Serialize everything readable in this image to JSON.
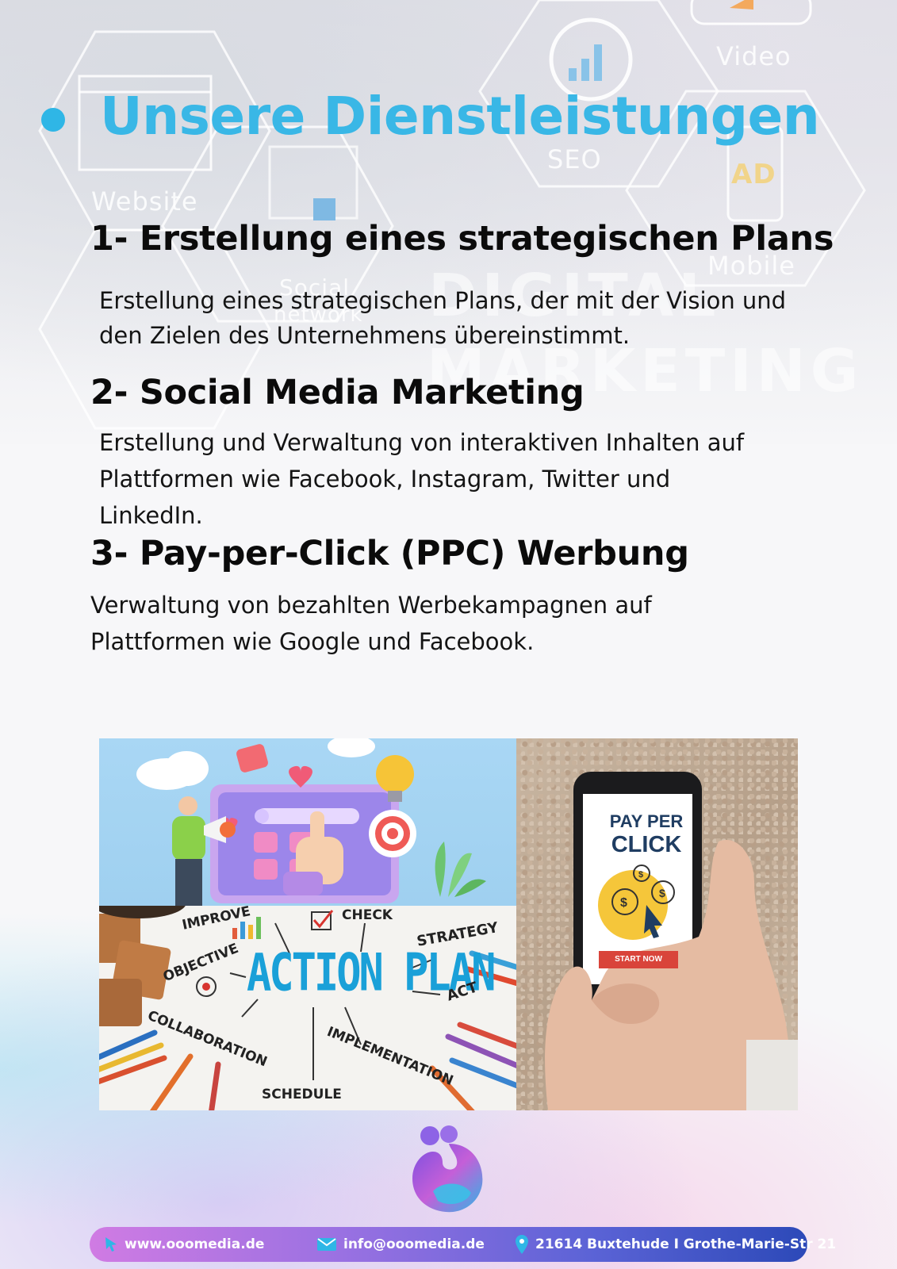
{
  "header": {
    "title": "Unsere Dienstleistungen",
    "background_words": {
      "video": "Video",
      "seo": "SEO",
      "website": "Website",
      "ad": "AD",
      "mobile": "Mobile",
      "social": "Social",
      "network": "network",
      "digital": "DIGITAL",
      "marketing": "MARKETING"
    },
    "accent_color": "#39b7e6"
  },
  "services": [
    {
      "heading": "1- Erstellung eines strategischen Plans",
      "lines": [
        "Erstellung eines strategischen Plans, der mit der Vision und",
        "den Zielen des Unternehmens übereinstimmt."
      ]
    },
    {
      "heading": "2- Social Media Marketing",
      "lines": [
        "Erstellung und Verwaltung von interaktiven Inhalten auf",
        "Plattformen wie Facebook, Instagram, Twitter und",
        "LinkedIn."
      ]
    },
    {
      "heading": "3- Pay-per-Click (PPC) Werbung",
      "lines": [
        "Verwaltung von bezahlten Werbekampagnen auf",
        "Plattformen wie Google und Facebook."
      ]
    }
  ],
  "images": {
    "action_plan": {
      "title": "ACTION PLAN",
      "words": {
        "improve": "IMPROVE",
        "check": "CHECK",
        "strategy": "STRATEGY",
        "objective": "OBJECTIVE",
        "act": "ACT",
        "collaboration": "COLLABORATION",
        "implementation": "IMPLEMENTATION",
        "schedule": "SCHEDULE"
      }
    },
    "ppc": {
      "line1": "PAY PER",
      "line2": "CLICK",
      "button": "START NOW"
    }
  },
  "footer": {
    "website": "www.ooomedia.de",
    "email": "info@ooomedia.de",
    "address": "21614 Buxtehude I Grothe-Marie-Str 21",
    "icons": [
      "cursor-icon",
      "mail-icon",
      "location-pin-icon"
    ],
    "gradient": [
      "#d07be3",
      "#2c49b8"
    ]
  }
}
